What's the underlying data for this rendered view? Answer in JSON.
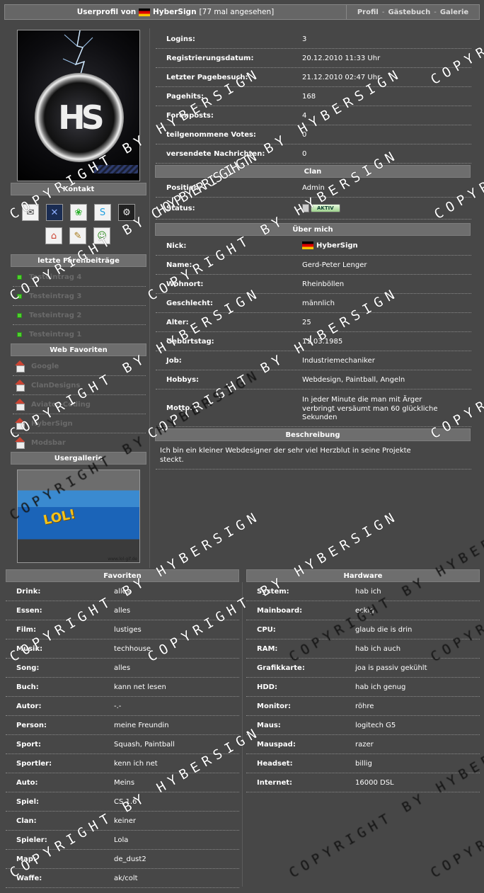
{
  "header": {
    "title_prefix": "Userprofil von",
    "username": "HyberSign",
    "views": "[77 mal angesehen]",
    "nav": [
      "Profil",
      "Gästebuch",
      "Galerie"
    ],
    "nav_sep": "-"
  },
  "avatar": {
    "monogram": "HS"
  },
  "sidebar": {
    "contact_title": "Kontakt",
    "contact_icons": [
      "mail-icon",
      "xfire-icon",
      "icq-icon",
      "skype-icon",
      "steam-icon",
      "homepage-icon",
      "guestbook-icon",
      "add-buddy-icon"
    ],
    "posts_title": "letzte Forenbeiträge",
    "posts": [
      "Testeintrag 4",
      "Testeintrag 3",
      "Testeintrag 2",
      "Testeintrag 1"
    ],
    "favorites_title": "Web Favoriten",
    "web_favorites": [
      "Google",
      "ClanDesigns",
      "Aviator-Coding",
      "HyberSign",
      "Modsbar"
    ],
    "gallery_title": "Usergallerie",
    "gallery_text": "LOL!",
    "gallery_caption": "www.lol-gif.de"
  },
  "stats": [
    {
      "label": "Logins:",
      "value": "3"
    },
    {
      "label": "Registrierungsdatum:",
      "value": "20.12.2010 11:33 Uhr"
    },
    {
      "label": "Letzter Pagebesuch:",
      "value": "21.12.2010 02:47 Uhr"
    },
    {
      "label": "Pagehits:",
      "value": "168"
    },
    {
      "label": "Forenposts:",
      "value": "4"
    },
    {
      "label": "teilgenommene Votes:",
      "value": "0"
    },
    {
      "label": "versendete Nachrichten:",
      "value": "0"
    }
  ],
  "clan": {
    "title": "Clan",
    "position_label": "Position:",
    "position_value": "Admin",
    "status_label": "Status:",
    "status_badge": "AKTIV"
  },
  "about": {
    "title": "Über mich",
    "rows": [
      {
        "label": "Nick:",
        "value": "HyberSign"
      },
      {
        "label": "Name:",
        "value": "Gerd-Peter Lenger"
      },
      {
        "label": "Wohnort:",
        "value": "Rheinböllen"
      },
      {
        "label": "Geschlecht:",
        "value": "männlich"
      },
      {
        "label": "Alter:",
        "value": "25"
      },
      {
        "label": "Geburtstag:",
        "value": "11.03.1985"
      },
      {
        "label": "Job:",
        "value": "Industriemechaniker"
      },
      {
        "label": "Hobbys:",
        "value": "Webdesign, Paintball, Angeln"
      }
    ],
    "motto_label": "Motto:",
    "motto_lines": [
      "In jeder Minute die man mit Ärger",
      "verbringt versäumt man 60 glückliche",
      "Sekunden"
    ]
  },
  "description": {
    "title": "Beschreibung",
    "lines": [
      "Ich bin ein kleiner Webdesigner der sehr viel Herzblut in seine Projekte",
      "steckt."
    ]
  },
  "favorites": {
    "title": "Favoriten",
    "rows": [
      {
        "label": "Drink:",
        "value": "alles"
      },
      {
        "label": "Essen:",
        "value": "alles"
      },
      {
        "label": "Film:",
        "value": "lustiges"
      },
      {
        "label": "Musik:",
        "value": "techhouse"
      },
      {
        "label": "Song:",
        "value": "alles"
      },
      {
        "label": "Buch:",
        "value": "kann net lesen"
      },
      {
        "label": "Autor:",
        "value": "-.-"
      },
      {
        "label": "Person:",
        "value": "meine Freundin"
      },
      {
        "label": "Sport:",
        "value": "Squash, Paintball"
      },
      {
        "label": "Sportler:",
        "value": "kenn ich net"
      },
      {
        "label": "Auto:",
        "value": "Meins"
      },
      {
        "label": "Spiel:",
        "value": "CS 1.6"
      },
      {
        "label": "Clan:",
        "value": "keiner"
      },
      {
        "label": "Spieler:",
        "value": "Lola"
      },
      {
        "label": "Map:",
        "value": "de_dust2"
      },
      {
        "label": "Waffe:",
        "value": "ak/colt"
      }
    ]
  },
  "hardware": {
    "title": "Hardware",
    "rows": [
      {
        "label": "System:",
        "value": "hab ich"
      },
      {
        "label": "Mainboard:",
        "value": "eckig"
      },
      {
        "label": "CPU:",
        "value": "glaub die is drin"
      },
      {
        "label": "RAM:",
        "value": "hab ich auch"
      },
      {
        "label": "Grafikkarte:",
        "value": "joa is passiv gekühlt"
      },
      {
        "label": "HDD:",
        "value": "hab ich genug"
      },
      {
        "label": "Monitor:",
        "value": "röhre"
      },
      {
        "label": "Maus:",
        "value": "logitech G5"
      },
      {
        "label": "Mauspad:",
        "value": "razer"
      },
      {
        "label": "Headset:",
        "value": "billig"
      },
      {
        "label": "Internet:",
        "value": "16000 DSL"
      }
    ]
  },
  "watermark": "COPYRIGHT BY HYBERSIGN"
}
